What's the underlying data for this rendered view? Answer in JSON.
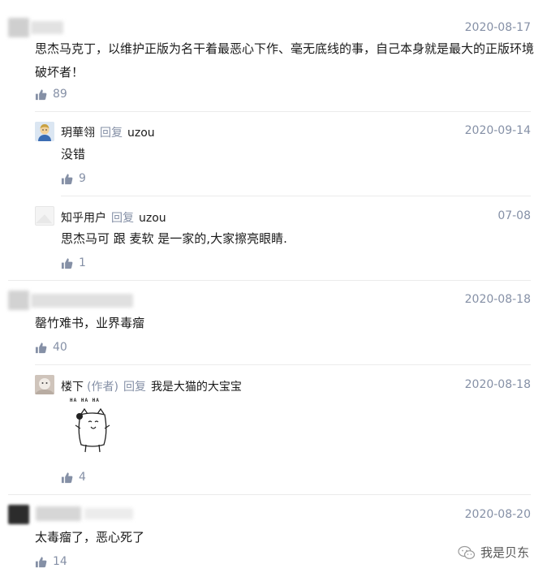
{
  "comments": [
    {
      "date": "2020-08-17",
      "text_line1": "思杰马克丁，以维护正版为名干着最恶心下作、毫无底线的事，自己本身就是最大的正版环境",
      "text_line2": "破坏者！",
      "likes": "89",
      "replies": [
        {
          "name": "玥華翎",
          "reply_label": "回复",
          "reply_to": "uzou",
          "date": "2020-09-14",
          "text": "没错",
          "likes": "9"
        },
        {
          "name": "知乎用户",
          "reply_label": "回复",
          "reply_to": "uzou",
          "date": "07-08",
          "text": "思杰马可 跟 麦软 是一家的,大家擦亮眼睛.",
          "likes": "1"
        }
      ]
    },
    {
      "date": "2020-08-18",
      "text": "罄竹难书，业界毒瘤",
      "likes": "40",
      "replies": [
        {
          "name": "楼下",
          "author_tag": "(作者)",
          "reply_label": "回复",
          "reply_to": "我是大猫的大宝宝",
          "date": "2020-08-18",
          "sticker_text": "HA HA HA",
          "likes": "4"
        }
      ]
    },
    {
      "date": "2020-08-20",
      "text": "太毒瘤了，恶心死了",
      "likes": "14"
    }
  ],
  "watermark": "我是贝东",
  "colors": {
    "meta": "#8590a6",
    "text": "#1a1a1a",
    "divider": "#ebebeb"
  }
}
